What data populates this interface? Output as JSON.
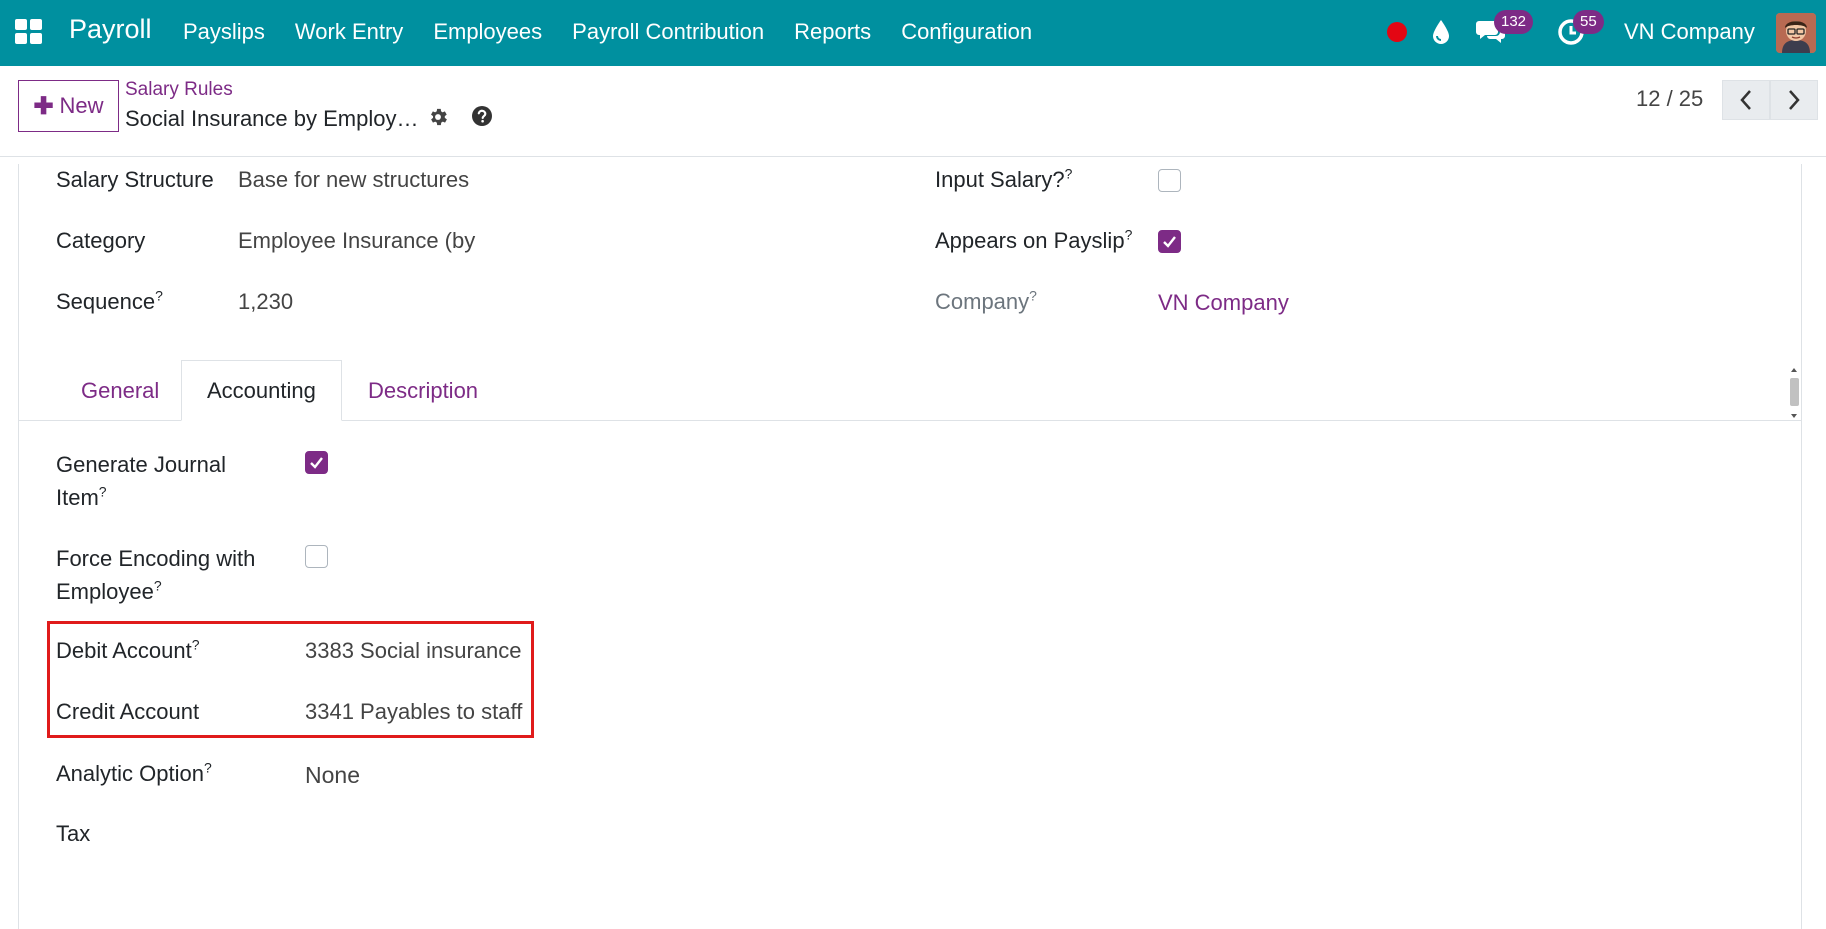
{
  "navbar": {
    "app_name": "Payroll",
    "menu": [
      "Payslips",
      "Work Entry",
      "Employees",
      "Payroll Contribution",
      "Reports",
      "Configuration"
    ],
    "messages_count": "132",
    "activities_count": "55",
    "company": "VN Company",
    "icons": [
      "apps-grid-icon",
      "recording-dot-icon",
      "drop-icon",
      "chat-icon",
      "clock-icon"
    ],
    "colors": {
      "bar": "#00909f",
      "badge": "#7d2b86",
      "record_dot": "#e30613"
    }
  },
  "control": {
    "new_label": "New",
    "breadcrumb_parent": "Salary Rules",
    "record_title": "Social Insurance by Employ…",
    "pager": "12 / 25"
  },
  "form": {
    "left": {
      "salary_structure": {
        "label": "Salary Structure",
        "value": "Base for new structures"
      },
      "category": {
        "label": "Category",
        "value": "Employee Insurance (by"
      },
      "sequence": {
        "label": "Sequence",
        "value": "1,230"
      }
    },
    "right": {
      "input_salary": {
        "label": "Input Salary?",
        "checked": false
      },
      "appears_on_payslip": {
        "label": "Appears on Payslip",
        "checked": true
      },
      "company": {
        "label": "Company",
        "value": "VN Company"
      }
    },
    "help_mark": "?"
  },
  "tabs": [
    "General",
    "Accounting",
    "Description"
  ],
  "active_tab": "Accounting",
  "accounting": {
    "generate_journal_item": {
      "label_line1": "Generate Journal",
      "label_line2": "Item",
      "checked": true
    },
    "force_encoding": {
      "label_line1": "Force Encoding with",
      "label_line2": "Employee",
      "checked": false
    },
    "debit_account": {
      "label": "Debit Account",
      "value": "3383 Social insurance"
    },
    "credit_account": {
      "label": "Credit Account",
      "value": "3341 Payables to staff"
    },
    "analytic_option": {
      "label": "Analytic Option",
      "value": "None"
    },
    "tax": {
      "label": "Tax"
    }
  },
  "accent_color": "#7d2b86",
  "highlight_color": "#e01b1b"
}
